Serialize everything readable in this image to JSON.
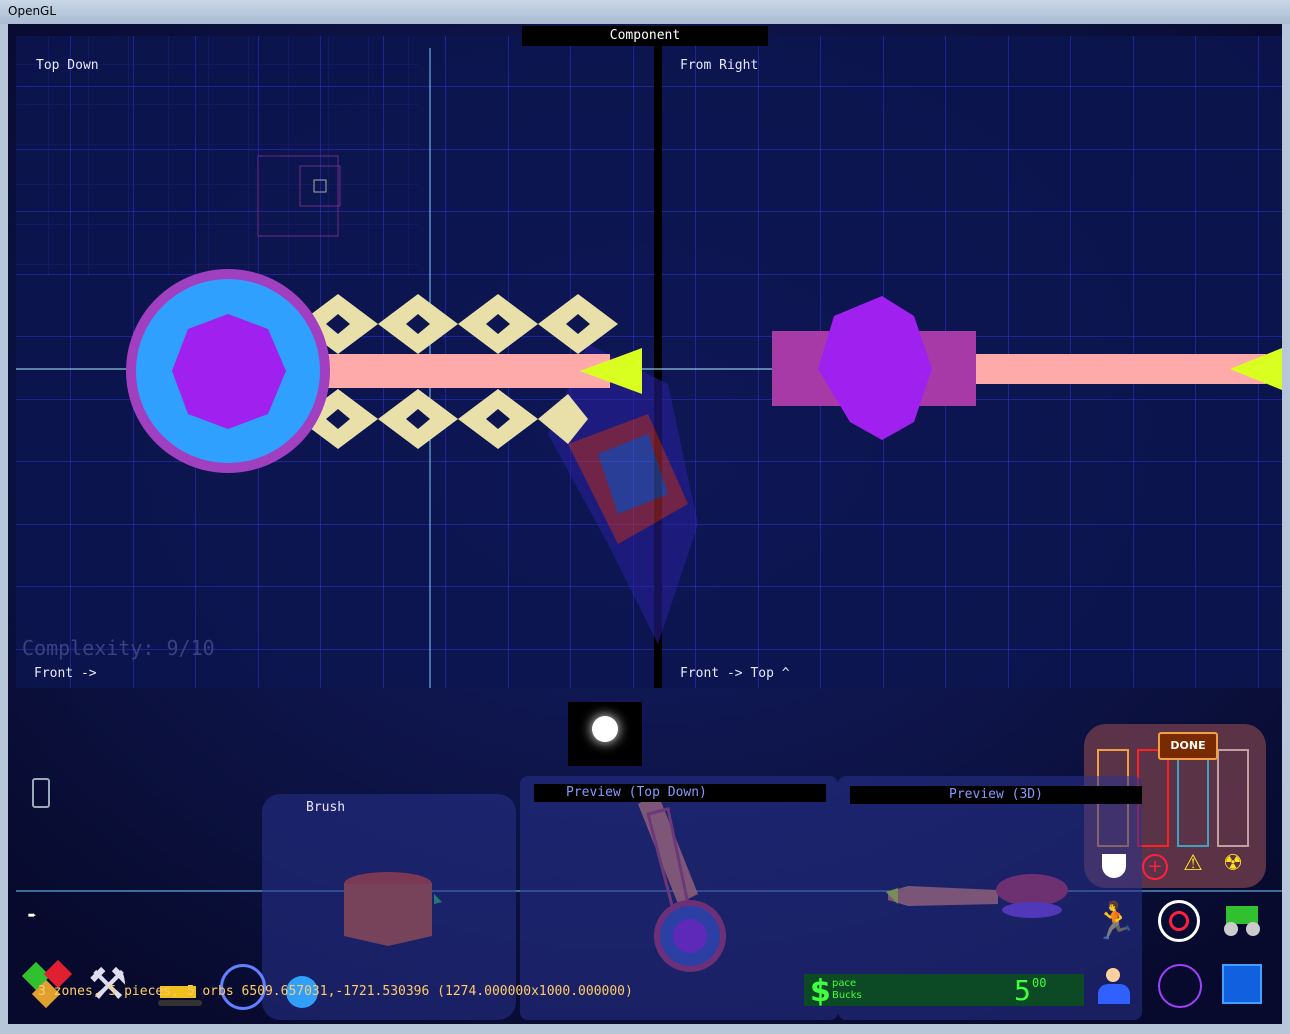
{
  "window": {
    "title": "OpenGL"
  },
  "header": {
    "component_label": "Component"
  },
  "views": {
    "top_down": "Top Down",
    "from_right": "From Right",
    "front_left": "Front ->",
    "front_right": "Front -> Top ^",
    "complexity": "Complexity: 9/10"
  },
  "panels": {
    "brush": "Brush",
    "preview_top": "Preview (Top Down)",
    "preview_3d": "Preview (3D)"
  },
  "status_line": "3 zones, 5 pieces, 5 orbs 6509.657031,-1721.530396 (1274.000000x1000.000000)",
  "bucks": {
    "label_line1": "pace",
    "label_line2": "Bucks",
    "amount": "5",
    "cents": "00"
  },
  "done_button": "DONE",
  "colors": {
    "grid_bg": "#0d1550",
    "accent": "#3a3aff",
    "violet": "#a020f0",
    "cyan": "#30a0ff",
    "pink": "#ffaaaa",
    "lime": "#d8ff20"
  },
  "icons": [
    "phone-icon",
    "arrow-icon",
    "cubes-icon",
    "tools-icon",
    "excavator-icon",
    "planet-icon",
    "flask-icon",
    "runner-icon",
    "target-icon",
    "tractor-icon",
    "people-icon",
    "network-icon",
    "map-icon",
    "shield-icon",
    "health-icon",
    "warning-icon",
    "radiation-icon",
    "lightbulb-icon"
  ]
}
